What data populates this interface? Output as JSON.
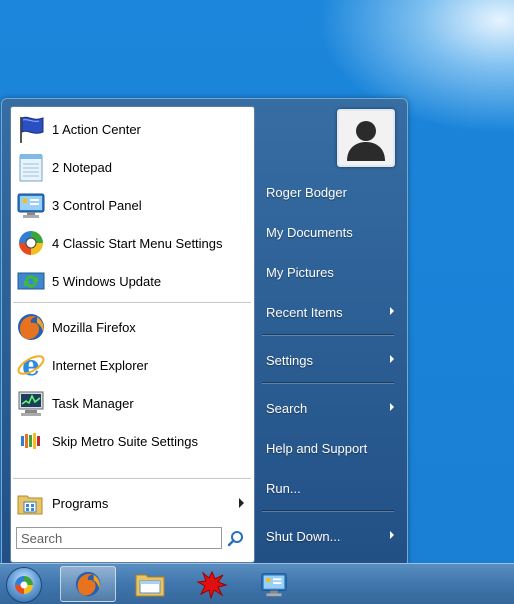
{
  "left_items": [
    {
      "label": "1 Action Center",
      "icon": "action-center-flag-icon"
    },
    {
      "label": "2 Notepad",
      "icon": "notepad-icon"
    },
    {
      "label": "3 Control Panel",
      "icon": "control-panel-icon"
    },
    {
      "label": "4 Classic Start Menu Settings",
      "icon": "classic-shell-icon"
    },
    {
      "label": "5 Windows Update",
      "icon": "windows-update-icon"
    },
    {
      "label": "Mozilla Firefox",
      "icon": "firefox-icon"
    },
    {
      "label": "Internet Explorer",
      "icon": "internet-explorer-icon"
    },
    {
      "label": "Task Manager",
      "icon": "task-manager-icon"
    },
    {
      "label": "Skip Metro Suite Settings",
      "icon": "skip-metro-icon"
    }
  ],
  "programs": {
    "label": "Programs",
    "icon": "programs-folder-icon"
  },
  "search": {
    "placeholder": "Search",
    "value": ""
  },
  "right_items": [
    {
      "label": "Roger Bodger",
      "submenu": false
    },
    {
      "label": "My Documents",
      "submenu": false
    },
    {
      "label": "My Pictures",
      "submenu": false
    },
    {
      "label": "Recent Items",
      "submenu": true
    },
    {
      "label": "Settings",
      "submenu": true
    },
    {
      "label": "Search",
      "submenu": true
    },
    {
      "label": "Help and Support",
      "submenu": false
    },
    {
      "label": "Run...",
      "submenu": false
    },
    {
      "label": "Shut Down...",
      "submenu": true
    }
  ],
  "taskbar": {
    "items": [
      "start-orb-icon",
      "firefox-icon",
      "file-explorer-icon",
      "paint-splash-icon",
      "control-panel-icon"
    ],
    "active": "firefox-icon"
  },
  "colors": {
    "accent": "#1b86db",
    "menu_right": "#2f5f93"
  }
}
